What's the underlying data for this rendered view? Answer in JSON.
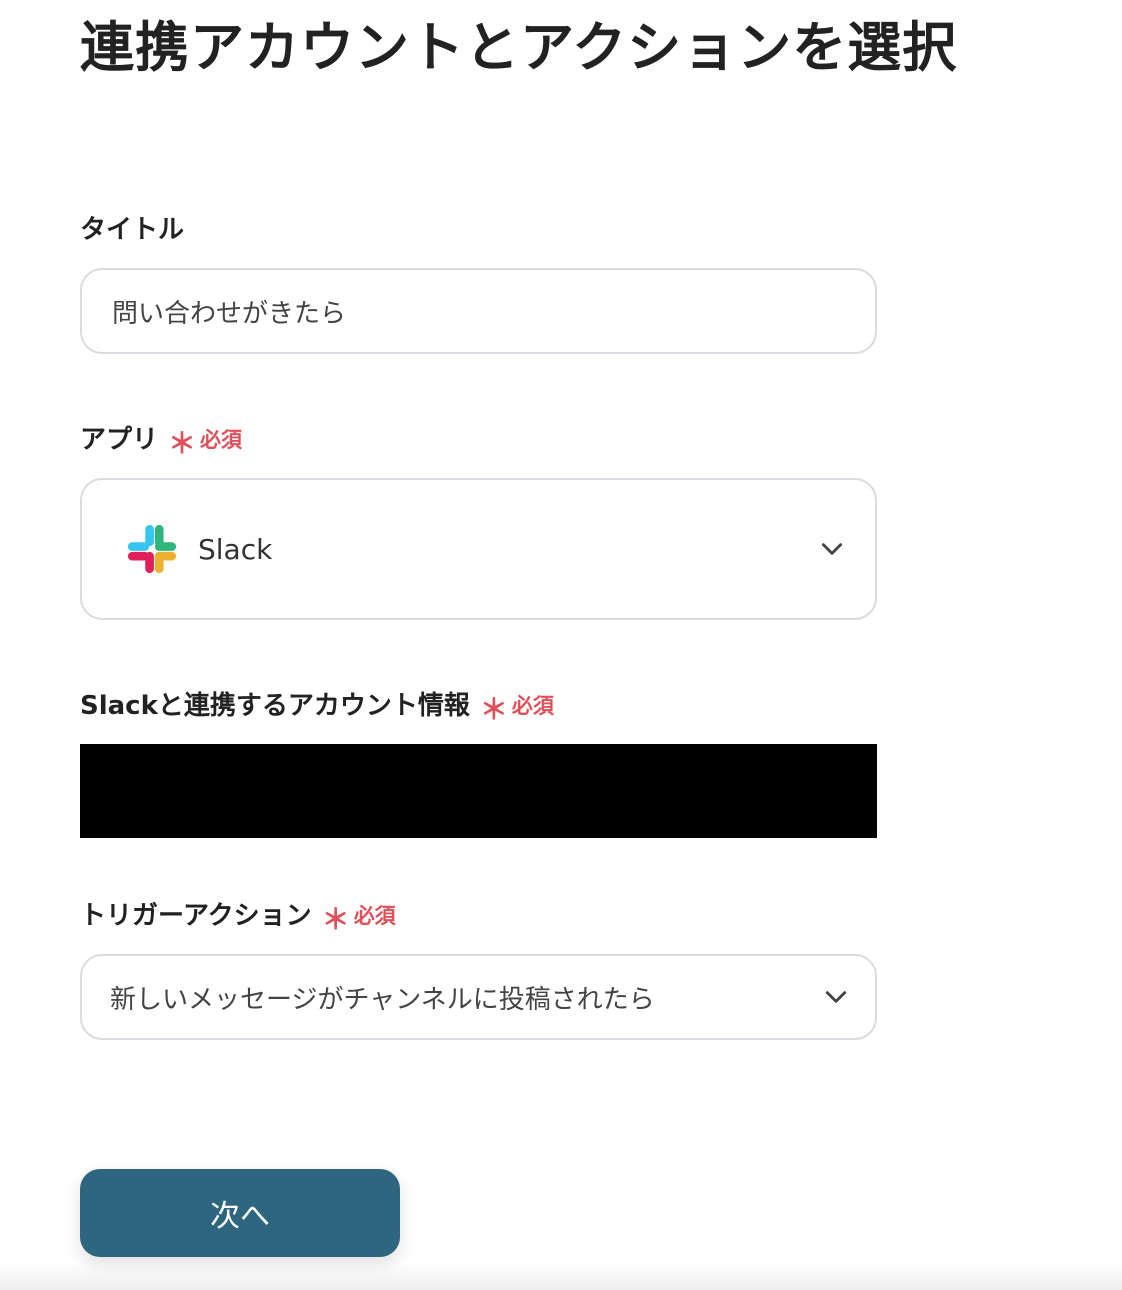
{
  "page": {
    "title": "連携アカウントとアクションを選択"
  },
  "title_field": {
    "label": "タイトル",
    "value": "問い合わせがきたら"
  },
  "app_field": {
    "label": "アプリ",
    "required_mark": "＊",
    "required_text": "必須",
    "selected_app": "Slack",
    "icon": "slack-logo-icon"
  },
  "account_field": {
    "label": "Slackと連携するアカウント情報",
    "required_mark": "＊",
    "required_text": "必須"
  },
  "trigger_field": {
    "label": "トリガーアクション",
    "required_mark": "＊",
    "required_text": "必須",
    "selected_value": "新しいメッセージがチャンネルに投稿されたら"
  },
  "footer": {
    "next_label": "次へ"
  },
  "colors": {
    "primary_button": "#2e6680",
    "required": "#e0505a",
    "border": "#d9dbe0",
    "text": "#222222"
  }
}
